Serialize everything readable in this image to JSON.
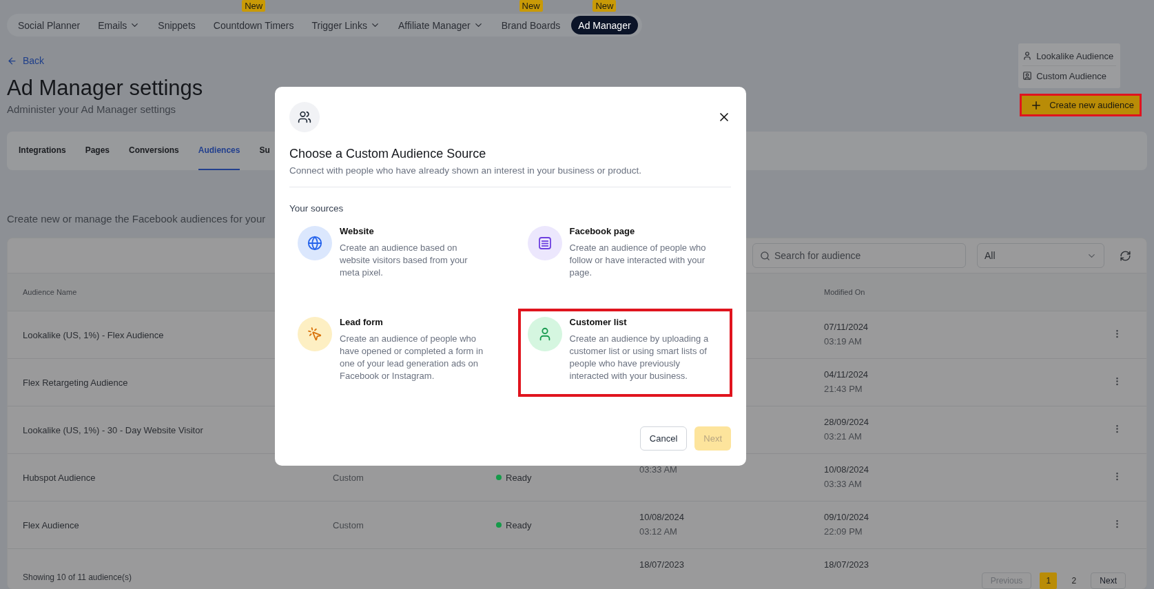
{
  "nav": {
    "items": [
      {
        "label": "Social Planner",
        "dropdown": false,
        "selected": false
      },
      {
        "label": "Emails",
        "dropdown": true,
        "selected": false
      },
      {
        "label": "Snippets",
        "dropdown": false,
        "selected": false
      },
      {
        "label": "Countdown Timers",
        "dropdown": false,
        "selected": false,
        "badge": "New"
      },
      {
        "label": "Trigger Links",
        "dropdown": true,
        "selected": false
      },
      {
        "label": "Affiliate Manager",
        "dropdown": true,
        "selected": false
      },
      {
        "label": "Brand Boards",
        "dropdown": false,
        "selected": false,
        "badge": "New"
      },
      {
        "label": "Ad Manager",
        "dropdown": false,
        "selected": true,
        "badge": "New"
      }
    ]
  },
  "back": "Back",
  "title": "Ad Manager settings",
  "subtitle": "Administer your Ad Manager settings",
  "create_menu": {
    "items": [
      {
        "label": "Lookalike Audience",
        "kind": "lookalike"
      },
      {
        "label": "Custom Audience",
        "kind": "custom"
      }
    ]
  },
  "create_button": {
    "label": "Create new audience",
    "highlighted": true
  },
  "tabs": [
    {
      "label": "Integrations",
      "selected": false
    },
    {
      "label": "Pages",
      "selected": false
    },
    {
      "label": "Conversions",
      "selected": false
    },
    {
      "label": "Audiences",
      "selected": true
    },
    {
      "label": "Su",
      "selected": false
    }
  ],
  "description": "Create new or manage the Facebook audiences for your",
  "table": {
    "search": {
      "placeholder": "Search for audience"
    },
    "filter": {
      "value": "All"
    },
    "header": {
      "name": "Audience Name",
      "modified_on": "Modified On"
    },
    "rows": [
      {
        "name": "Lookalike (US, 1%) - Flex Audience",
        "modified": {
          "date": "07/11/2024",
          "time": "03:19 AM"
        }
      },
      {
        "name": "Flex Retargeting Audience",
        "modified": {
          "date": "04/11/2024",
          "time": "21:43 PM"
        }
      },
      {
        "name": "Lookalike (US, 1%) - 30 - Day Website Visitor",
        "modified": {
          "date": "28/09/2024",
          "time": "03:21 AM"
        }
      },
      {
        "name": "Hubspot Audience",
        "type": "Custom",
        "status": "Ready",
        "created": {
          "time": "03:33 AM"
        },
        "modified": {
          "date": "10/08/2024",
          "time": "03:33 AM"
        }
      },
      {
        "name": "Flex Audience",
        "type": "Custom",
        "status": "Ready",
        "created": {
          "date": "10/08/2024",
          "time": "03:12 AM"
        },
        "modified": {
          "date": "09/10/2024",
          "time": "22:09 PM"
        }
      },
      {
        "created": {
          "date": "18/07/2023"
        },
        "modified": {
          "date": "18/07/2023"
        }
      }
    ],
    "footer": "Showing 10 of 11 audience(s)",
    "pagination": {
      "previous": {
        "label": "Previous",
        "disabled": true
      },
      "pages": [
        {
          "label": "1",
          "selected": true
        },
        {
          "label": "2",
          "selected": false
        }
      ],
      "next": {
        "label": "Next",
        "disabled": false
      }
    }
  },
  "modal": {
    "title": "Choose a Custom Audience Source",
    "subtitle": "Connect with people who have already shown an interest in your business or product.",
    "section": "Your sources",
    "sources": [
      {
        "kind": "website",
        "title": "Website",
        "description": "Create an audience based on website visitors based from your meta pixel.",
        "highlighted": false
      },
      {
        "kind": "facebook_page",
        "title": "Facebook page",
        "description": "Create an audience of people who follow or have interacted with your page.",
        "highlighted": false
      },
      {
        "kind": "lead_form",
        "title": "Lead form",
        "description": "Create an audience of people who have opened or completed a form in one of your lead generation ads on Facebook or Instagram.",
        "highlighted": false
      },
      {
        "kind": "customer_list",
        "title": "Customer list",
        "description": "Create an audience by uploading a customer list or using smart lists of people who have previously interacted with your business.",
        "highlighted": true
      }
    ],
    "cancel": "Cancel",
    "next": {
      "label": "Next",
      "disabled": true
    }
  }
}
